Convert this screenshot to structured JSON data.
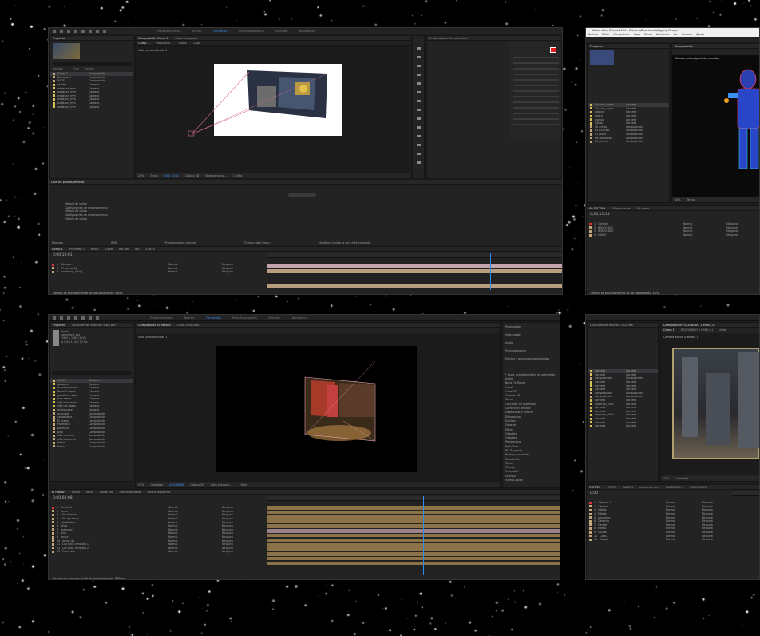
{
  "colors": {
    "accent": "#2d8ceb",
    "bg": "#000000",
    "panel": "#232323",
    "label_red": "#e0303a",
    "label_tan": "#c4a67a",
    "label_yellow": "#d8c253",
    "comp_color": "#b08d55"
  },
  "win1": {
    "workspaces": [
      "Predeterminado",
      "Revisar",
      "Formación",
      "Pantalla pequeña",
      "Estándar",
      "Bibliotecas"
    ],
    "active_workspace": "Formación",
    "project_tab": "Proyecto",
    "comp_tab": "Composición Comp 1",
    "layer_tab": "Capa (ninguna)",
    "comp_subtabs": [
      "Comp 1",
      "Preocomp 1",
      "RAGE",
      "Capa"
    ],
    "viewer_label": "Vista personalizada 1",
    "project_items": [
      {
        "name": "Comp 1",
        "type": "Composición",
        "color": "#c4a67a"
      },
      {
        "name": "Precomp 1",
        "type": "Composición",
        "color": "#c4a67a"
      },
      {
        "name": "RAGE",
        "type": "Composición",
        "color": "#c4a67a"
      },
      {
        "name": "sólidos",
        "type": "Carpeta",
        "color": "#d8c253"
      },
      {
        "name": "wadeson_mm",
        "type": "Carpeta",
        "color": "#d8c253"
      },
      {
        "name": "wadeson_mm",
        "type": "Carpeta",
        "color": "#d8c253"
      },
      {
        "name": "wadeson_mm",
        "type": "Carpeta",
        "color": "#d8c253"
      },
      {
        "name": "wadeson_mm",
        "type": "Carpeta",
        "color": "#d8c253"
      },
      {
        "name": "wadeson_mm",
        "type": "Carpeta",
        "color": "#d8c253"
      },
      {
        "name": "wadeson_mm",
        "type": "Carpeta",
        "color": "#d8c253"
      }
    ],
    "zoom": "20%",
    "quality": "Tercia",
    "timecode": "0;00;10;01",
    "renderer": "Clásico 3D",
    "view_mode": "Vista personal...",
    "view_count": "1 Vista",
    "render_queue_title": "Cola de procesamiento",
    "rq_rows": [
      "Módulo de salida",
      "Configuración de procesamiento",
      "Módulo de salida",
      "Configuración de procesamiento",
      "Módulo de salida"
    ],
    "status": [
      "Mensaje",
      "RAM",
      "Procesamiento iniciado",
      "Tiempo total trans.:"
    ],
    "notify": "Notificar cuando la cola esté completa",
    "timeline_tabs": [
      "Comp 1",
      "Precomp 1",
      "RAGE",
      "Capa",
      "ojo del",
      "ojo",
      "LENTE"
    ],
    "timeline_time": "0;00;10;01",
    "layers": [
      "Cámara 1",
      "[Precomp 1]",
      "[wadeson_color]"
    ],
    "layer_mode": "Normal",
    "parent": "Ninguno",
    "footer": "Tiempo de procesamiento de los fotogramas: 34ms"
  },
  "win2": {
    "title": "Adobe After Effects 2024 - C:\\Users\\Downloads\\Rigging V3.aep *",
    "menu": [
      "Archivo",
      "Editar",
      "Composición",
      "Capa",
      "Efecto",
      "Animación",
      "Ver",
      "Ventana",
      "Ayuda"
    ],
    "comp_tab": "Composición",
    "viewer_label": "Cámara activa (predeterminada)",
    "project_items": [
      {
        "name": "3d core_capas",
        "type": "Carpeta"
      },
      {
        "name": "3d core_capas",
        "type": "Carpeta"
      },
      {
        "name": "cabeza",
        "type": "Carpeta"
      },
      {
        "name": "rostro",
        "type": "Carpeta"
      },
      {
        "name": "cuerpo",
        "type": "Carpeta"
      },
      {
        "name": "Sólido",
        "type": "Carpeta"
      },
      {
        "name": "00 orbita",
        "type": "Composición"
      },
      {
        "name": "00 ESCENA",
        "type": "Composición"
      },
      {
        "name": "01 plano",
        "type": "Composición"
      },
      {
        "name": "del personaje",
        "type": "Composición"
      },
      {
        "name": "01 pierna",
        "type": "Composición"
      }
    ],
    "zoom": "50%",
    "quality": "Tercia",
    "timeline_tabs": [
      "00 ESCENA",
      "00 personaje",
      "01 plano"
    ],
    "timecode": "0;00;11;14",
    "layers": [
      "Control",
      "BRAZO IZQ",
      "BRAZO DER",
      "MANO"
    ],
    "props": [
      "Punto de anclaje",
      "Posición",
      "Escala",
      "Rotación",
      "Opacidad",
      "Transformar",
      "Punto de anclaje",
      "Posición",
      "Escala"
    ],
    "values": [
      "0,0,0",
      "262,170",
      "71,25",
      "-100,0,100%",
      "0x+0,0°",
      "100%"
    ],
    "layer_mode": "Normal",
    "parent": "Ninguno",
    "footer": "Tiempo de procesamiento de los fotogramas: 34ms"
  },
  "win3": {
    "workspaces": [
      "Predeterminado",
      "Revisar",
      "Formación",
      "Pantalla pequeña",
      "Estándar",
      "Bibliotecas"
    ],
    "active_workspace": "Formación",
    "project_tab": "Proyecto",
    "effects_tab": "Controles de efectos: Vista per",
    "comp_tab": "Composición El maxon",
    "layer_tab": "Capa (ninguna)",
    "viewer_label": "Vista personalizada 1",
    "project_info": [
      "fondo",
      "utilizado 1 vez",
      "1920 x 1080 (1,00)",
      "Δ 0;00;11;00, 30 fps"
    ],
    "project_items": [
      {
        "name": "fondo",
        "type": "Carpeta",
        "color": "#d8c253"
      },
      {
        "name": "gusanos",
        "type": "Carpeta",
        "color": "#d8c253"
      },
      {
        "name": "escalera capas",
        "type": "Carpeta",
        "color": "#d8c253"
      },
      {
        "name": "Panel 4 capas",
        "type": "Carpeta",
        "color": "#d8c253"
      },
      {
        "name": "panel izq capas",
        "type": "Carpeta",
        "color": "#d8c253"
      },
      {
        "name": "piso capas",
        "type": "Carpeta",
        "color": "#d8c253"
      },
      {
        "name": "silla dch capas",
        "type": "Carpeta",
        "color": "#d8c253"
      },
      {
        "name": "silla izq capas",
        "type": "Carpeta",
        "color": "#d8c253"
      },
      {
        "name": "techo capas",
        "type": "Carpeta",
        "color": "#d8c253"
      },
      {
        "name": "ascensor",
        "type": "Composición",
        "color": "#c4a67a"
      },
      {
        "name": "candelabro",
        "type": "Composición",
        "color": "#c4a67a"
      },
      {
        "name": "El maxon",
        "type": "Composición",
        "color": "#c4a67a"
      },
      {
        "name": "Panel dch",
        "type": "Composición",
        "color": "#c4a67a"
      },
      {
        "name": "panel izq",
        "type": "Composición",
        "color": "#c4a67a"
      },
      {
        "name": "piso",
        "type": "Composición",
        "color": "#c4a67a"
      },
      {
        "name": "silla derecha",
        "type": "Composición",
        "color": "#c4a67a"
      },
      {
        "name": "silla izquierda",
        "type": "Composición",
        "color": "#c4a67a"
      },
      {
        "name": "techo",
        "type": "Composición",
        "color": "#c4a67a"
      },
      {
        "name": "fanto",
        "type": "Composición",
        "color": "#c4a67a"
      }
    ],
    "right_panels": [
      "Propiedades",
      "Información",
      "Audio",
      "Previsualización",
      "Efectos y ajustes preestablecidos"
    ],
    "effects_list": [
      "* Ajust. preestablecidos de animación",
      "Audio",
      "Boris FX Mocha",
      "Canal",
      "Canal 3D",
      "Cinema 4D",
      "Clave",
      "Controles de expresión",
      "Corrección de color",
      "Desenfocar y enfocar",
      "Distorsionar",
      "Estilizar",
      "Generar",
      "Malla",
      "Obsoleto",
      "Obsolete",
      "Perspectiva",
      "Red Giant",
      "RG Trapcode",
      "Ruido y granulado",
      "Simulación",
      "Texto",
      "Tiempo",
      "Transición",
      "Utilidad",
      "Video Copilot"
    ],
    "zoom": "25%",
    "quality": "Completa",
    "timecode": "0;00;06;00",
    "renderer": "Clásico 3D",
    "view_mode": "Vista personal...",
    "view_count": "1 Vista",
    "timeline_tabs": [
      "El maxon",
      "fondo",
      "fanto",
      "panel izq",
      "Pierna derecha",
      "Pierna izquierda"
    ],
    "timeline_time": "0;00;04;08",
    "layers": [
      "fanfarria",
      "fanto",
      "silla derecha",
      "silla izquierda",
      "candelabro",
      "Vista",
      "ascensor",
      "piso",
      "techo",
      "panel izq",
      "Luz Punt..embudo 1",
      "Luz Punt..embudo 2",
      "Panel dch"
    ],
    "layer_mode": "Normal",
    "parent": "Ninguno",
    "footer": "Tiempo de procesamiento de los fotogramas: 380ms"
  },
  "win4": {
    "effects_tab": "Controles de efectos: ESCENA",
    "comp_tab": "Composición ESCENARIO 1 MOD (1)",
    "sub_tabs": [
      "Comp 1",
      "ESCENARIO 1 MOD (1)",
      "debe"
    ],
    "viewer_label": "Cámara activa (Cámara 1)",
    "project_items": [
      {
        "name": "Carpeta",
        "type": "Carpeta",
        "color": "#d8c253"
      },
      {
        "name": "Carpeta",
        "type": "Carpeta",
        "color": "#d8c253"
      },
      {
        "name": "Composición",
        "type": "Composición",
        "color": "#c4a67a"
      },
      {
        "name": "Carpeta",
        "type": "Carpeta",
        "color": "#d8c253"
      },
      {
        "name": "Carpeta",
        "type": "Carpeta",
        "color": "#d8c253"
      },
      {
        "name": "Carpeta",
        "type": "Carpeta",
        "color": "#d8c253"
      },
      {
        "name": "Composición",
        "type": "Composición",
        "color": "#c4a67a"
      },
      {
        "name": "Composición",
        "type": "Composición",
        "color": "#c4a67a"
      },
      {
        "name": "Carpeta",
        "type": "Carpeta",
        "color": "#d8c253"
      },
      {
        "name": "Importar_MOV",
        "type": "Carpeta",
        "color": "#d8c253"
      },
      {
        "name": "Carpeta",
        "type": "Carpeta",
        "color": "#d8c253"
      },
      {
        "name": "Carpeta",
        "type": "Carpeta",
        "color": "#d8c253"
      },
      {
        "name": "Importar_MOV",
        "type": "Carpeta",
        "color": "#d8c253"
      },
      {
        "name": "Carpeta",
        "type": "Carpeta",
        "color": "#d8c253"
      },
      {
        "name": "Carpeta",
        "type": "Carpeta",
        "color": "#d8c253"
      },
      {
        "name": "Carpeta",
        "type": "Carpeta",
        "color": "#d8c253"
      }
    ],
    "zoom": "12%",
    "quality": "Completa",
    "timeline_tabs": [
      "CORTES",
      "CORTE",
      "BASE 1",
      "personal core",
      "FANTASMA 3",
      "ESCENARIO"
    ],
    "timecode": "0;00",
    "layers": [
      "Cámara 1",
      "Cámara",
      "Niebla",
      "Niebla",
      "Izquierda",
      "Derecha",
      "Centro",
      "Medio",
      "Escala",
      "Cielo 2",
      "Escala"
    ],
    "values": [
      "100,0,100,0%",
      "-1350,1304,-1000,0"
    ],
    "layer_mode": "Normal",
    "parent": "Ninguno"
  }
}
